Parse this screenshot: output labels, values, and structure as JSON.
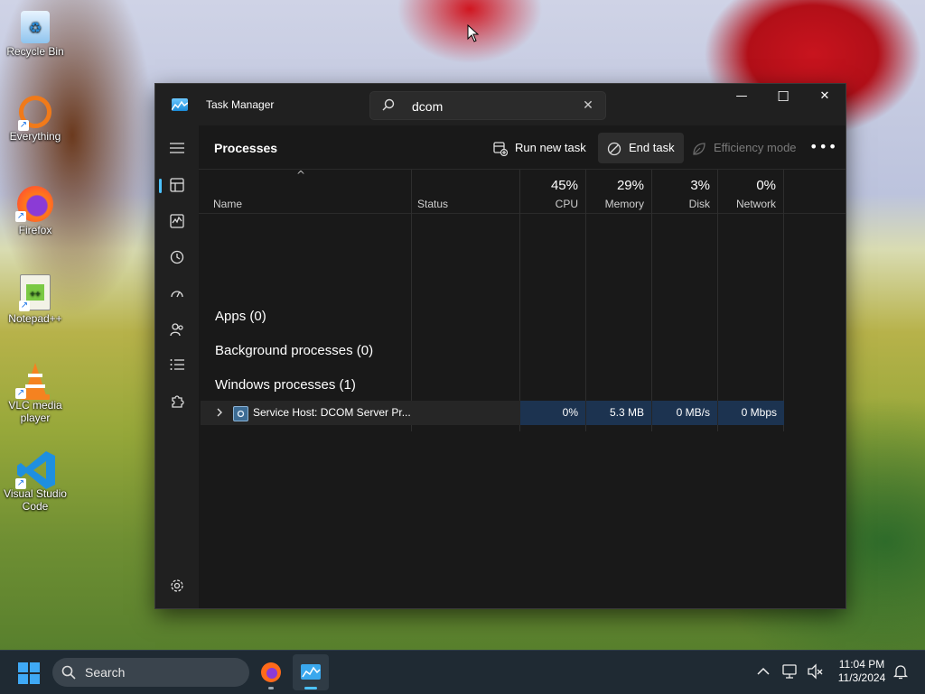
{
  "desktop": {
    "icons": [
      {
        "label": "Recycle Bin"
      },
      {
        "label": "Everything"
      },
      {
        "label": "Firefox"
      },
      {
        "label": "Notepad++"
      },
      {
        "label": "VLC media player"
      },
      {
        "label": "Visual Studio Code"
      }
    ]
  },
  "window": {
    "title": "Task Manager",
    "search_value": "dcom",
    "search_clear": "✕",
    "controls": {
      "minimize": "—",
      "maximize": "☐",
      "close": "✕"
    }
  },
  "command_bar": {
    "page_title": "Processes",
    "run_new_task": "Run new task",
    "end_task": "End task",
    "efficiency_mode": "Efficiency mode",
    "more": "•••"
  },
  "table": {
    "sort_indicator": "^",
    "columns": {
      "name": "Name",
      "status": "Status",
      "cpu": {
        "pct": "45%",
        "label": "CPU"
      },
      "memory": {
        "pct": "29%",
        "label": "Memory"
      },
      "disk": {
        "pct": "3%",
        "label": "Disk"
      },
      "network": {
        "pct": "0%",
        "label": "Network"
      }
    },
    "groups": {
      "apps": "Apps (0)",
      "background": "Background processes (0)",
      "windows": "Windows processes (1)"
    },
    "rows": [
      {
        "name": "Service Host: DCOM Server Pr...",
        "status": "",
        "cpu": "0%",
        "memory": "5.3 MB",
        "disk": "0 MB/s",
        "network": "0 Mbps"
      }
    ]
  },
  "taskbar": {
    "search_label": "Search",
    "time": "11:04 PM",
    "date": "11/3/2024"
  },
  "colors": {
    "accent": "#4cc2ff",
    "window_bg": "#191919",
    "highlight_cell": "#1c3350"
  }
}
